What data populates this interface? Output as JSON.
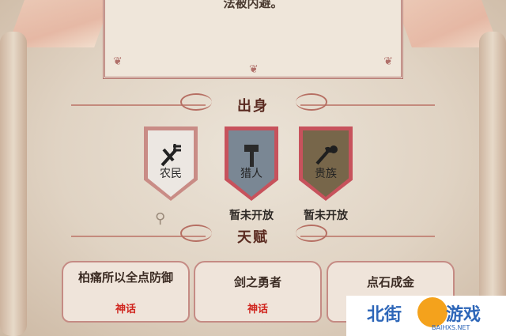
{
  "dialog": {
    "text": "法被内避。"
  },
  "origin": {
    "title": "出身",
    "badges": [
      {
        "label": "农民",
        "icon": "pitchfork-icon",
        "status": ""
      },
      {
        "label": "猎人",
        "icon": "hammer-icon",
        "status": "暂未开放"
      },
      {
        "label": "贵族",
        "icon": "axe-bag-icon",
        "status": "暂未开放"
      }
    ]
  },
  "talent": {
    "title": "天赋",
    "cards": [
      {
        "name": "柏痛所以全点防御",
        "rarity": "神话"
      },
      {
        "name": "剑之勇者",
        "rarity": "神话"
      },
      {
        "name": "点石成金",
        "rarity": ""
      }
    ]
  },
  "watermark": {
    "text_left": "北街",
    "text_right": "游戏",
    "sub": "BAIHXS.NET"
  },
  "colors": {
    "myth_red": "#d0261f",
    "frame": "#b2716a",
    "brand_blue": "#2d66b8",
    "brand_orange": "#f4a21c"
  }
}
